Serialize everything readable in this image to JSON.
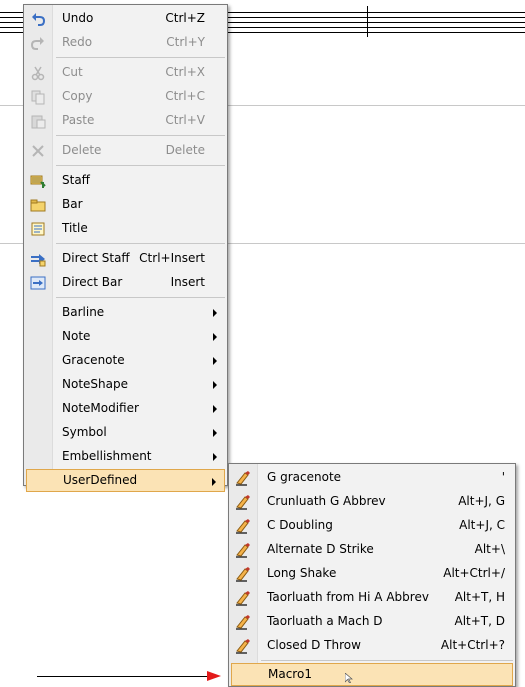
{
  "main_menu": {
    "items": [
      {
        "label": "Undo",
        "shortcut": "Ctrl+Z",
        "icon": "undo-icon",
        "disabled": false
      },
      {
        "label": "Redo",
        "shortcut": "Ctrl+Y",
        "icon": "redo-icon",
        "disabled": true
      },
      {
        "label": "Cut",
        "shortcut": "Ctrl+X",
        "icon": "scissors-icon",
        "disabled": true
      },
      {
        "label": "Copy",
        "shortcut": "Ctrl+C",
        "icon": "copy-icon",
        "disabled": true
      },
      {
        "label": "Paste",
        "shortcut": "Ctrl+V",
        "icon": "clipboard-icon",
        "disabled": true
      },
      {
        "label": "Delete",
        "shortcut": "Delete",
        "icon": "delete-x-icon",
        "disabled": true
      },
      {
        "label": "Staff",
        "icon": "staff-icon"
      },
      {
        "label": "Bar",
        "icon": "bar-icon"
      },
      {
        "label": "Title",
        "icon": "title-icon"
      },
      {
        "label": "Direct Staff",
        "shortcut": "Ctrl+Insert",
        "icon": "direct-staff-icon"
      },
      {
        "label": "Direct Bar",
        "shortcut": "Insert",
        "icon": "direct-bar-icon"
      },
      {
        "label": "Barline",
        "submenu": true
      },
      {
        "label": "Note",
        "submenu": true
      },
      {
        "label": "Gracenote",
        "submenu": true
      },
      {
        "label": "NoteShape",
        "submenu": true
      },
      {
        "label": "NoteModifier",
        "submenu": true
      },
      {
        "label": "Symbol",
        "submenu": true
      },
      {
        "label": "Embellishment",
        "submenu": true
      },
      {
        "label": "UserDefined",
        "submenu": true,
        "highlighted": true
      }
    ]
  },
  "user_defined_menu": {
    "items": [
      {
        "label": "G gracenote",
        "shortcut": "'",
        "icon": "hand-pen-icon"
      },
      {
        "label": "Crunluath G Abbrev",
        "shortcut": "Alt+J, G",
        "icon": "hand-pen-icon"
      },
      {
        "label": "C Doubling",
        "shortcut": "Alt+J, C",
        "icon": "hand-pen-icon"
      },
      {
        "label": "Alternate D Strike",
        "shortcut": "Alt+\\",
        "icon": "hand-pen-icon"
      },
      {
        "label": "Long Shake",
        "shortcut": "Alt+Ctrl+/",
        "icon": "hand-pen-icon"
      },
      {
        "label": "Taorluath from Hi A Abbrev",
        "shortcut": "Alt+T, H",
        "icon": "hand-pen-icon"
      },
      {
        "label": "Taorluath a Mach D",
        "shortcut": "Alt+T, D",
        "icon": "hand-pen-icon"
      },
      {
        "label": "Closed D Throw",
        "shortcut": "Alt+Ctrl+?",
        "icon": "hand-pen-icon"
      },
      {
        "label": "Macro1",
        "highlighted": true
      }
    ]
  },
  "colors": {
    "highlight_bg": "#fbe3b5",
    "highlight_border": "#e0a74b",
    "menu_bg": "#f2f2f2",
    "arrow": "#e31a1a"
  }
}
